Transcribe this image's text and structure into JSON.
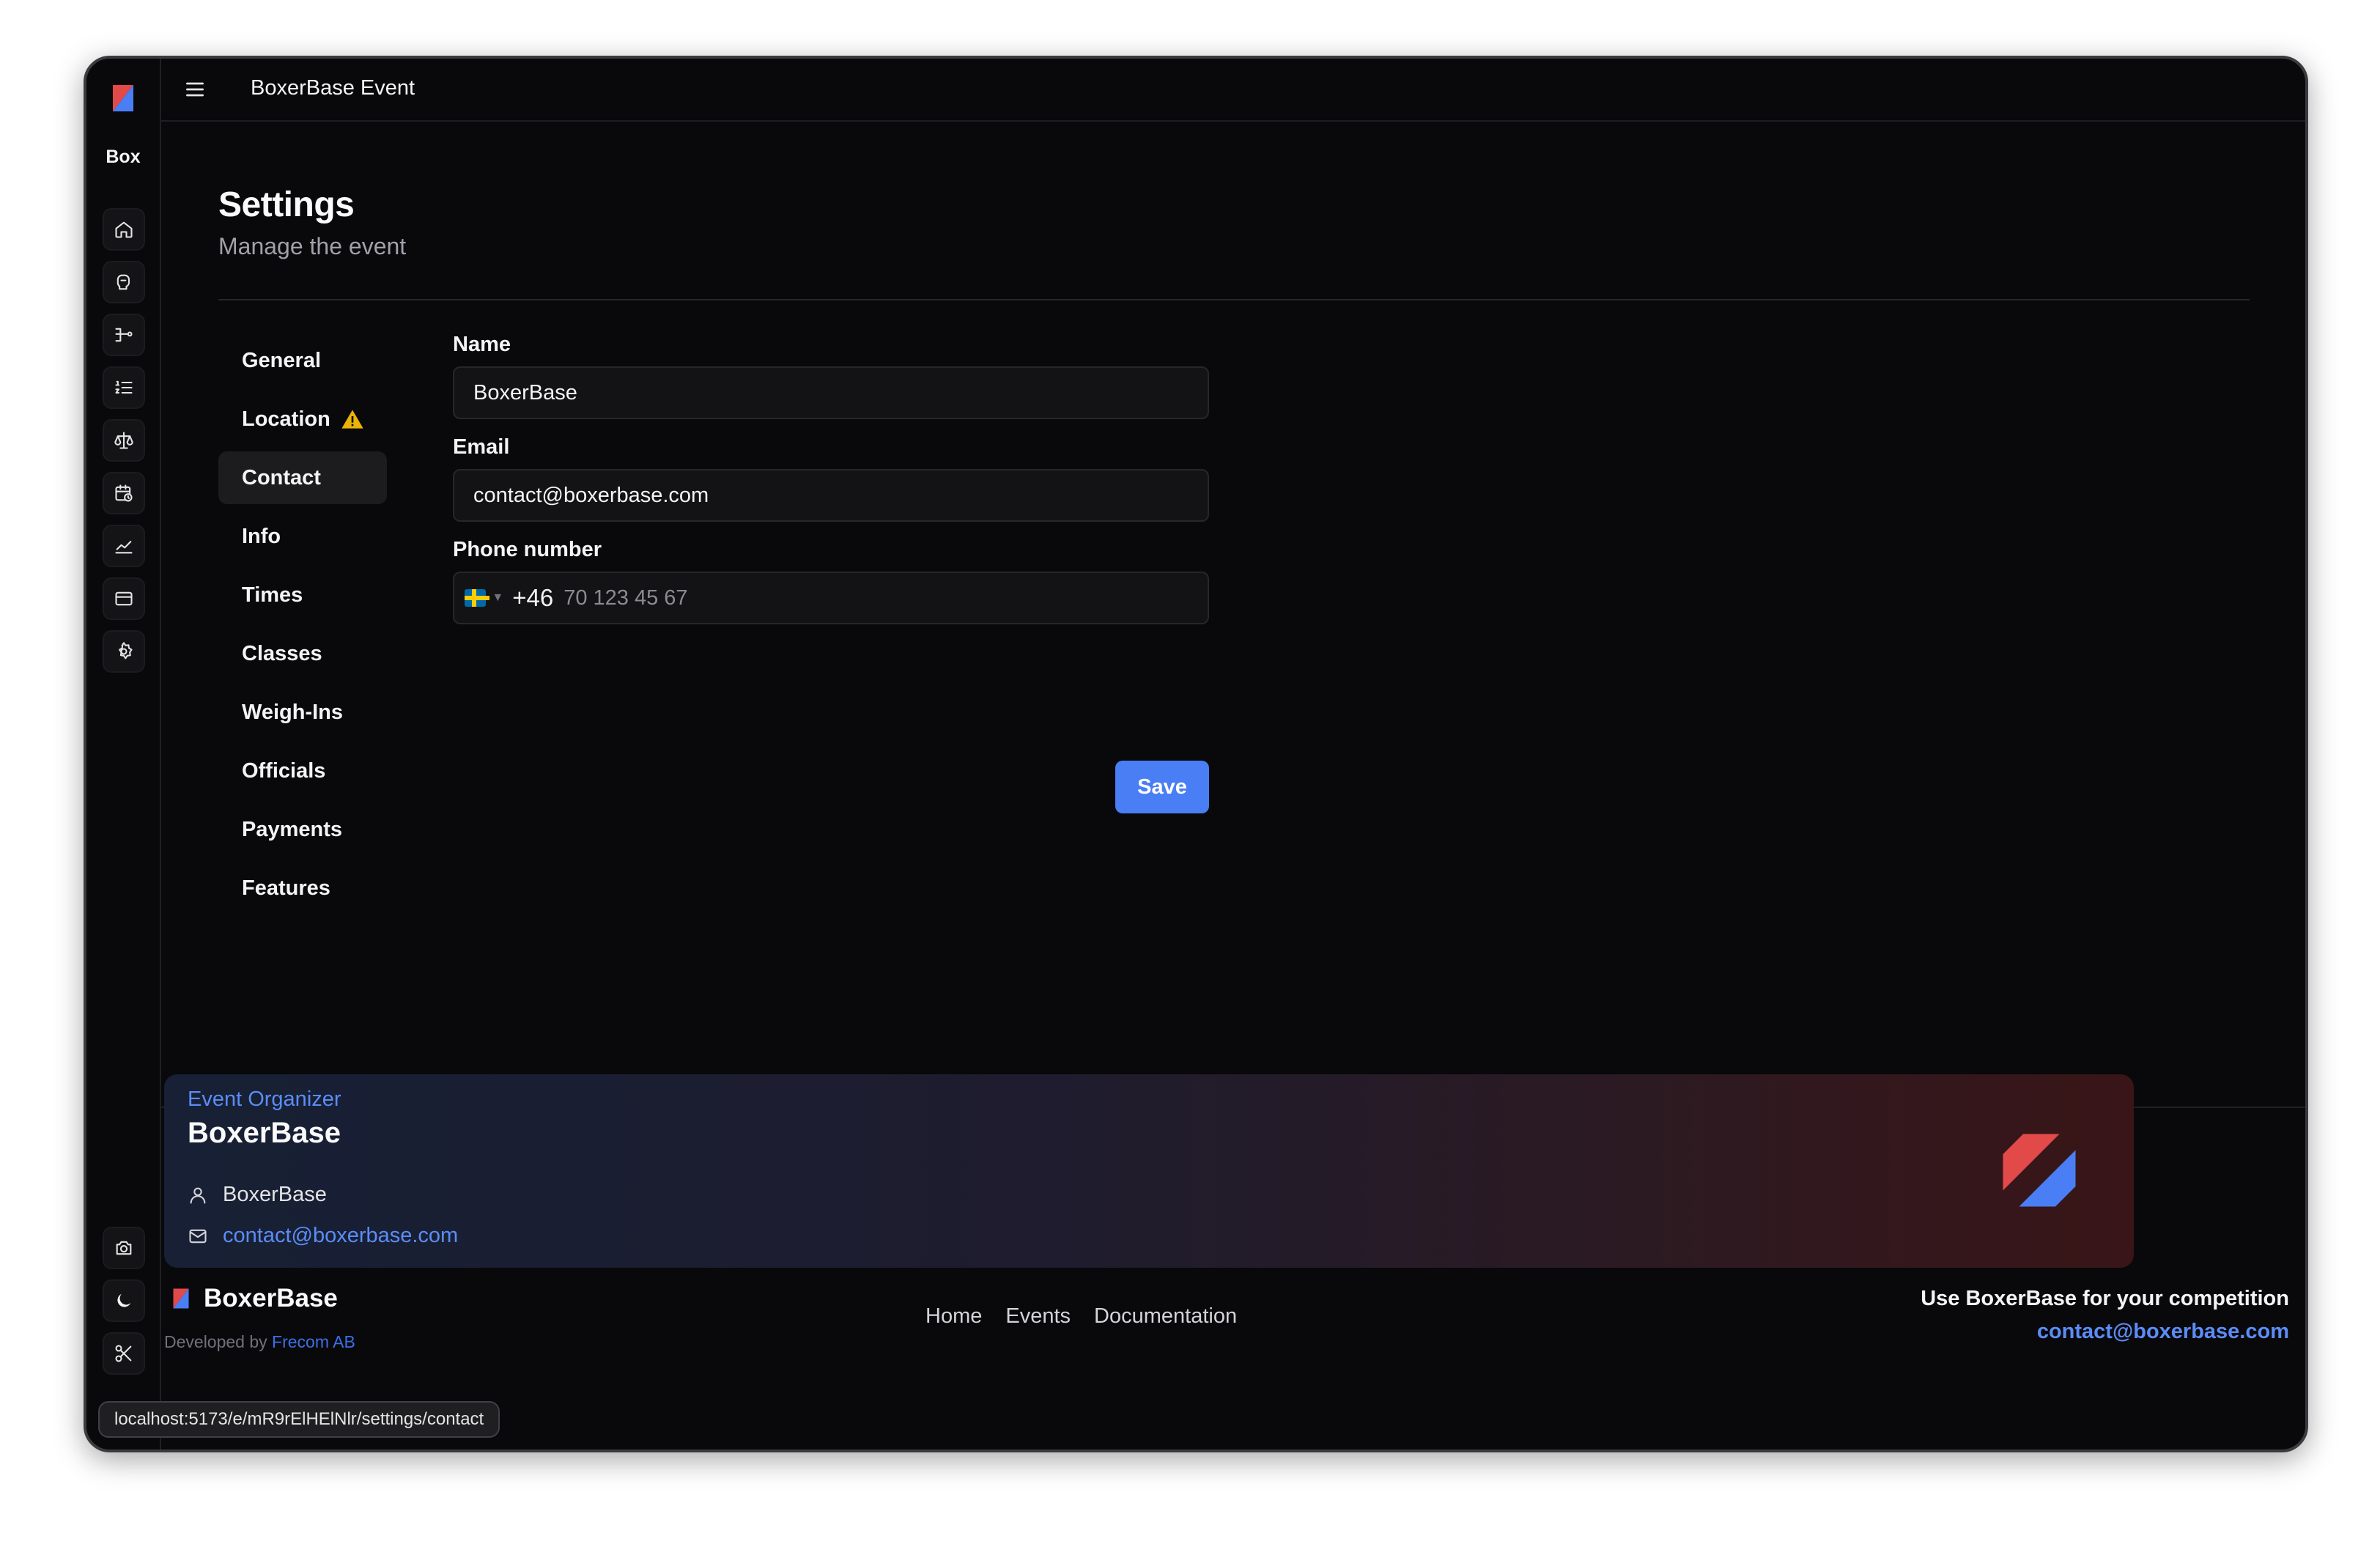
{
  "app": {
    "title": "BoxerBase Event",
    "rail_brand": "Box"
  },
  "rail": {
    "top_icons": [
      "home-icon",
      "glove-icon",
      "bracket-icon",
      "list-ordered-icon",
      "scale-icon",
      "calendar-clock-icon",
      "chart-icon",
      "card-icon",
      "settings-icon"
    ],
    "bottom_icons": [
      "camera-icon",
      "moon-icon",
      "scissors-icon"
    ]
  },
  "page": {
    "title": "Settings",
    "subtitle": "Manage the event"
  },
  "subnav": {
    "items": [
      {
        "label": "General"
      },
      {
        "label": "Location",
        "warning": true
      },
      {
        "label": "Contact",
        "active": true
      },
      {
        "label": "Info"
      },
      {
        "label": "Times"
      },
      {
        "label": "Classes"
      },
      {
        "label": "Weigh-Ins"
      },
      {
        "label": "Officials"
      },
      {
        "label": "Payments"
      },
      {
        "label": "Features"
      }
    ]
  },
  "form": {
    "name_label": "Name",
    "name_value": "BoxerBase",
    "email_label": "Email",
    "email_value": "contact@boxerbase.com",
    "phone_label": "Phone number",
    "phone_dial_code": "+46",
    "phone_placeholder": "70 123 45 67",
    "save_label": "Save"
  },
  "organizer": {
    "label": "Event Organizer",
    "name": "BoxerBase",
    "contact_name": "BoxerBase",
    "contact_email": "contact@boxerbase.com"
  },
  "footer": {
    "brand": "BoxerBase",
    "developed_by_prefix": "Developed by ",
    "developed_by_name": "Frecom AB",
    "links": [
      "Home",
      "Events",
      "Documentation"
    ],
    "cta_text": "Use BoxerBase for your competition",
    "cta_email": "contact@boxerbase.com"
  },
  "status_bar": {
    "url": "localhost:5173/e/mR9rElHElNlr/settings/contact"
  },
  "colors": {
    "background": "#09090b",
    "accent": "#4a7ef5",
    "link": "#5b8cf7",
    "warning": "#eab308",
    "brand_red": "#e24a4a",
    "brand_blue": "#4a7ef5"
  }
}
